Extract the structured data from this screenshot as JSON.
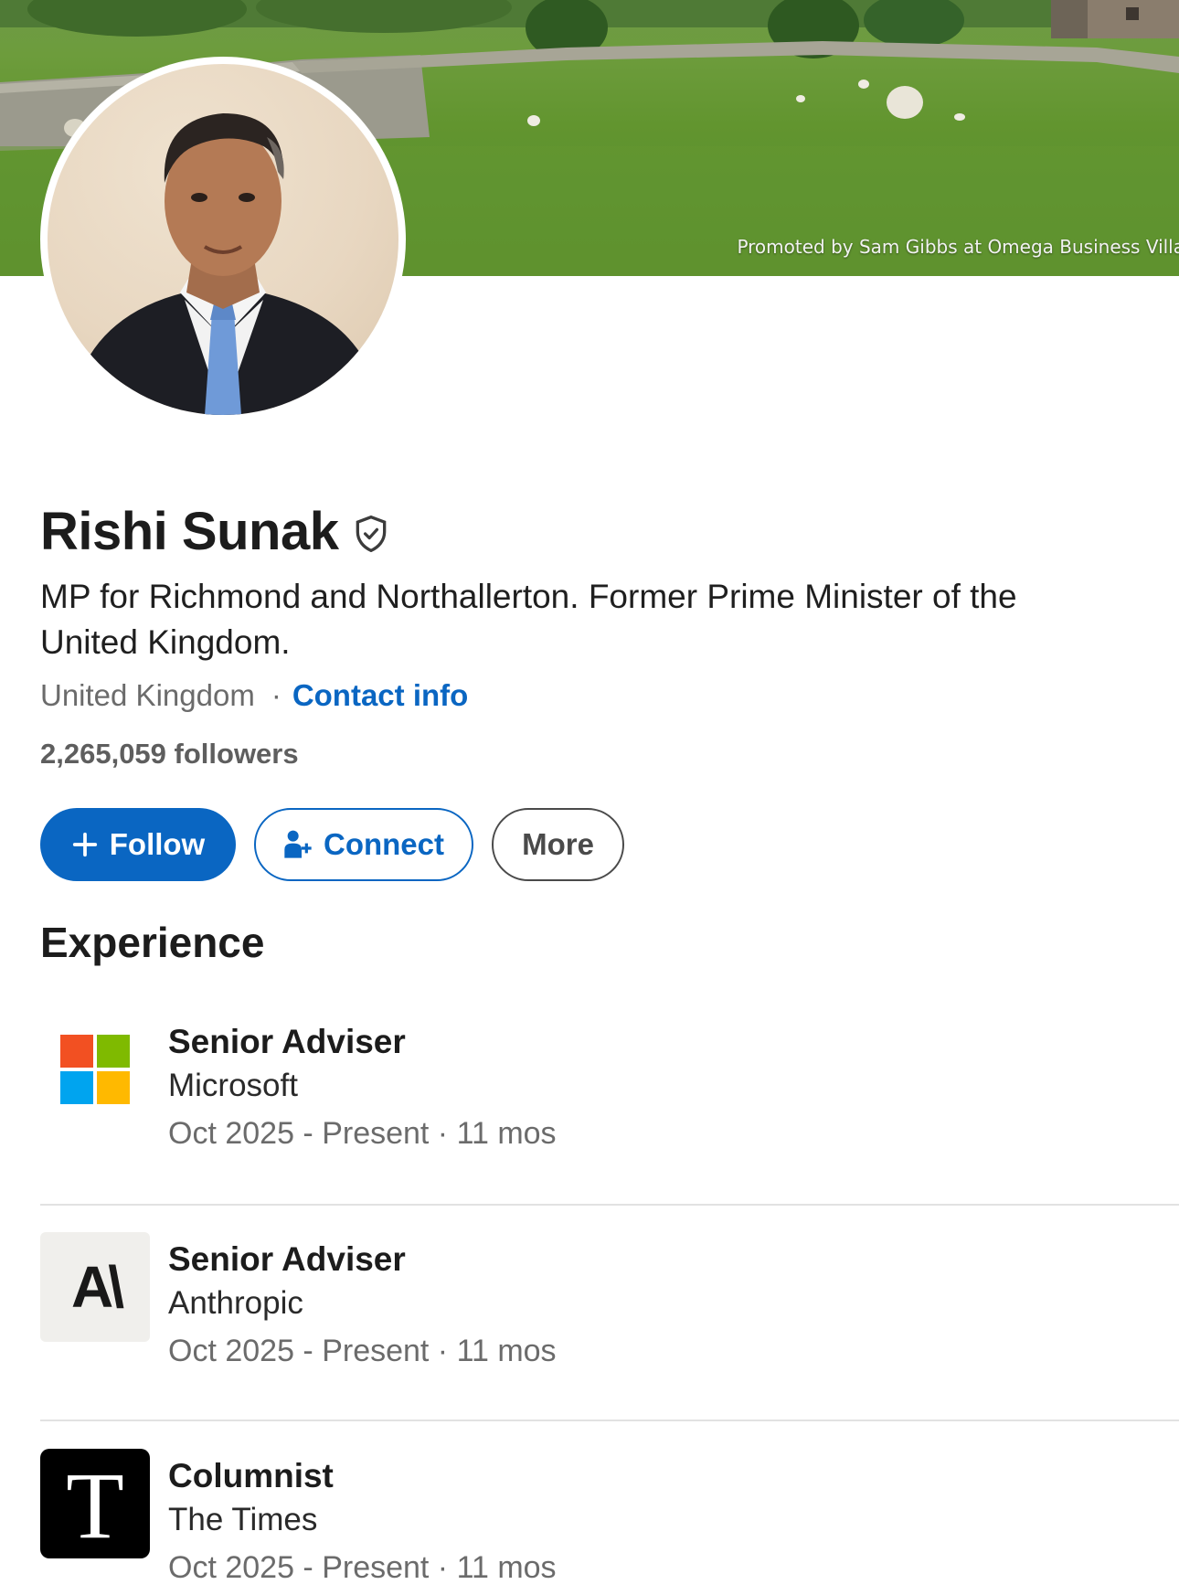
{
  "banner": {
    "promo_text": "Promoted by Sam Gibbs at Omega Business Villa"
  },
  "profile": {
    "name": "Rishi Sunak",
    "headline": "MP for Richmond and Northallerton. Former Prime Minister of the United Kingdom.",
    "location": "United Kingdom",
    "separator": "·",
    "contact_label": "Contact info",
    "followers": "2,265,059 followers"
  },
  "actions": {
    "follow_label": "Follow",
    "connect_label": "Connect",
    "more_label": "More"
  },
  "experience": {
    "title": "Experience",
    "items": [
      {
        "title": "Senior Adviser",
        "company": "Microsoft",
        "dates": "Oct 2025 - Present · 11 mos",
        "logo": "microsoft-logo"
      },
      {
        "title": "Senior Adviser",
        "company": "Anthropic",
        "dates": "Oct 2025 - Present · 11 mos",
        "logo": "anthropic-logo",
        "logo_text": "A\\"
      },
      {
        "title": "Columnist",
        "company": "The Times",
        "dates": "Oct 2025 - Present · 11 mos",
        "logo": "the-times-logo",
        "logo_text": "T"
      }
    ]
  },
  "colors": {
    "accent": "#0a66c2",
    "microsoft_red": "#f25022",
    "microsoft_green": "#7fba00",
    "microsoft_blue": "#00a4ef",
    "microsoft_yellow": "#ffb900"
  }
}
